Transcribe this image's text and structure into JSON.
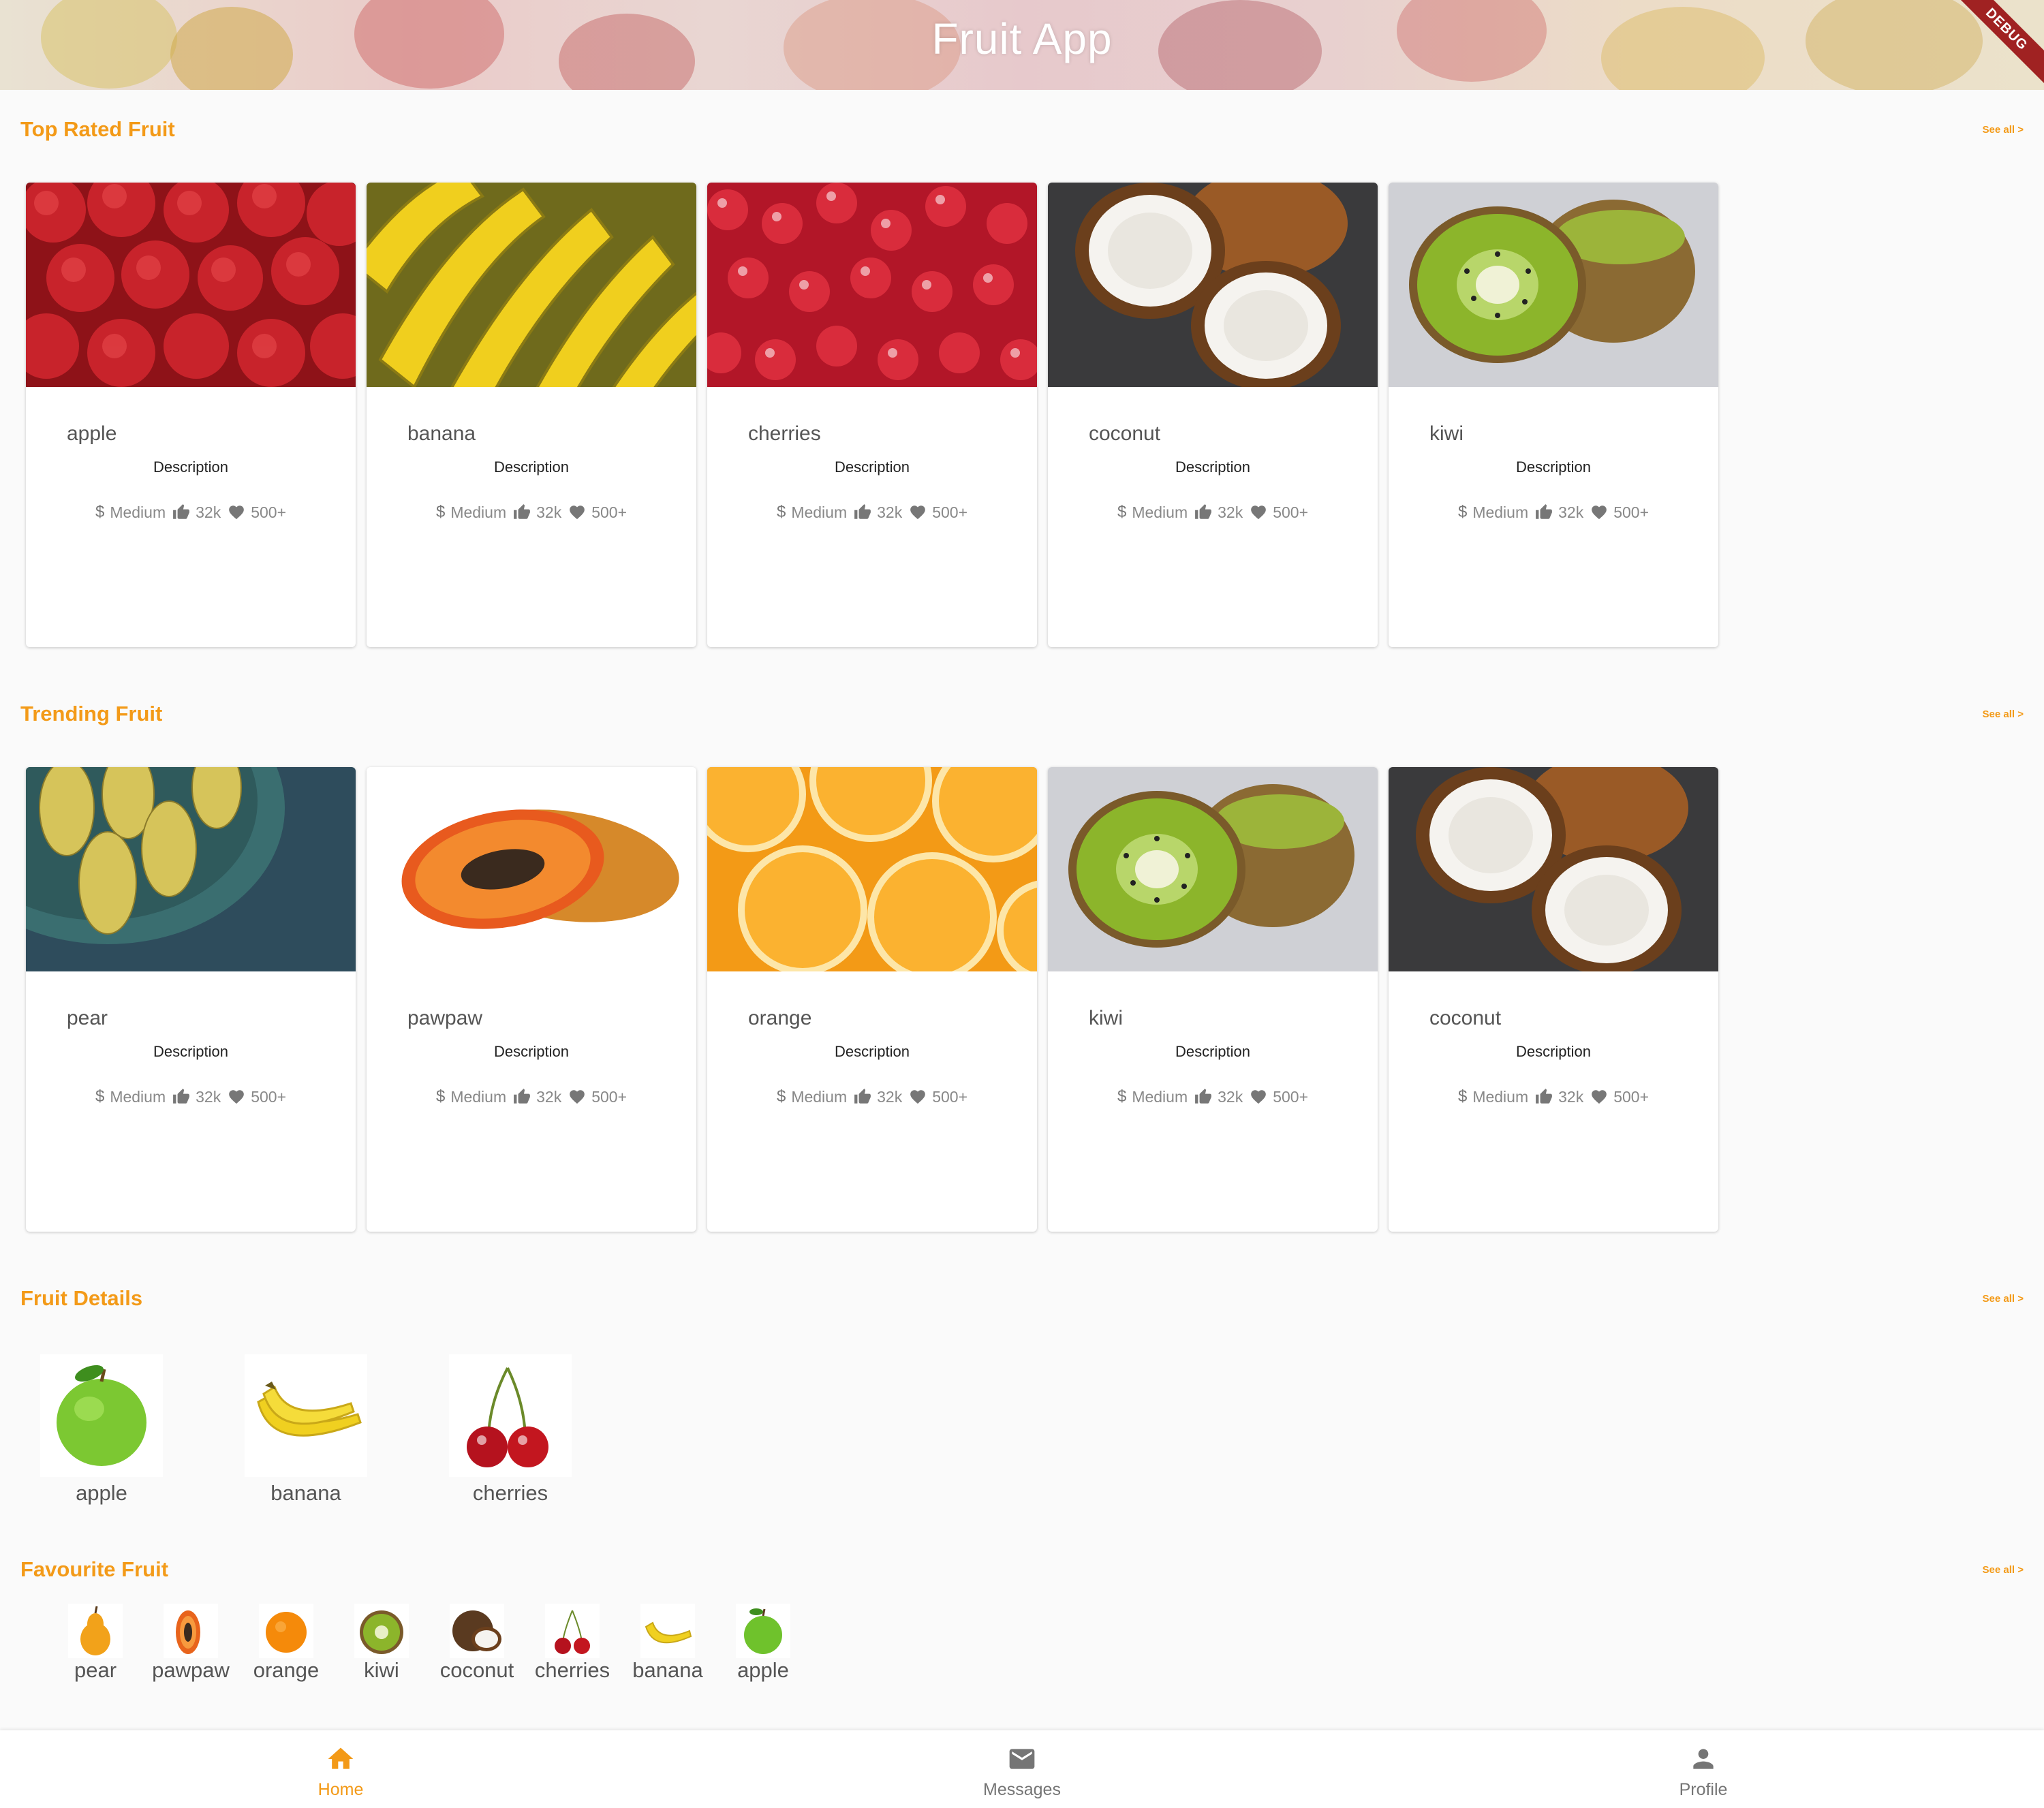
{
  "app": {
    "title": "Fruit App",
    "debug_banner": "DEBUG"
  },
  "colors": {
    "accent": "#f39a18",
    "text_muted": "#888888",
    "nav_inactive": "#757575"
  },
  "top_rated": {
    "title": "Top Rated Fruit",
    "see_all": "See all >",
    "cards": [
      {
        "name": "apple",
        "description": "Description",
        "price": "Medium",
        "likes": "32k",
        "favs": "500+"
      },
      {
        "name": "banana",
        "description": "Description",
        "price": "Medium",
        "likes": "32k",
        "favs": "500+"
      },
      {
        "name": "cherries",
        "description": "Description",
        "price": "Medium",
        "likes": "32k",
        "favs": "500+"
      },
      {
        "name": "coconut",
        "description": "Description",
        "price": "Medium",
        "likes": "32k",
        "favs": "500+"
      },
      {
        "name": "kiwi",
        "description": "Description",
        "price": "Medium",
        "likes": "32k",
        "favs": "500+"
      }
    ]
  },
  "trending": {
    "title": "Trending Fruit",
    "see_all": "See all >",
    "cards": [
      {
        "name": "pear",
        "description": "Description",
        "price": "Medium",
        "likes": "32k",
        "favs": "500+"
      },
      {
        "name": "pawpaw",
        "description": "Description",
        "price": "Medium",
        "likes": "32k",
        "favs": "500+"
      },
      {
        "name": "orange",
        "description": "Description",
        "price": "Medium",
        "likes": "32k",
        "favs": "500+"
      },
      {
        "name": "kiwi",
        "description": "Description",
        "price": "Medium",
        "likes": "32k",
        "favs": "500+"
      },
      {
        "name": "coconut",
        "description": "Description",
        "price": "Medium",
        "likes": "32k",
        "favs": "500+"
      }
    ]
  },
  "fruit_details": {
    "title": "Fruit Details",
    "see_all": "See all >",
    "items": [
      "apple",
      "banana",
      "cherries"
    ]
  },
  "favourites": {
    "title": "Favourite Fruit",
    "see_all": "See all >",
    "items": [
      "pear",
      "pawpaw",
      "orange",
      "kiwi",
      "coconut",
      "cherries",
      "banana",
      "apple"
    ]
  },
  "bottom_nav": {
    "items": [
      {
        "label": "Home",
        "icon": "home-icon",
        "active": true
      },
      {
        "label": "Messages",
        "icon": "mail-icon",
        "active": false
      },
      {
        "label": "Profile",
        "icon": "person-icon",
        "active": false
      }
    ]
  },
  "icons": {
    "price": "dollar-icon",
    "likes": "thumb-up-icon",
    "favs": "heart-icon"
  }
}
